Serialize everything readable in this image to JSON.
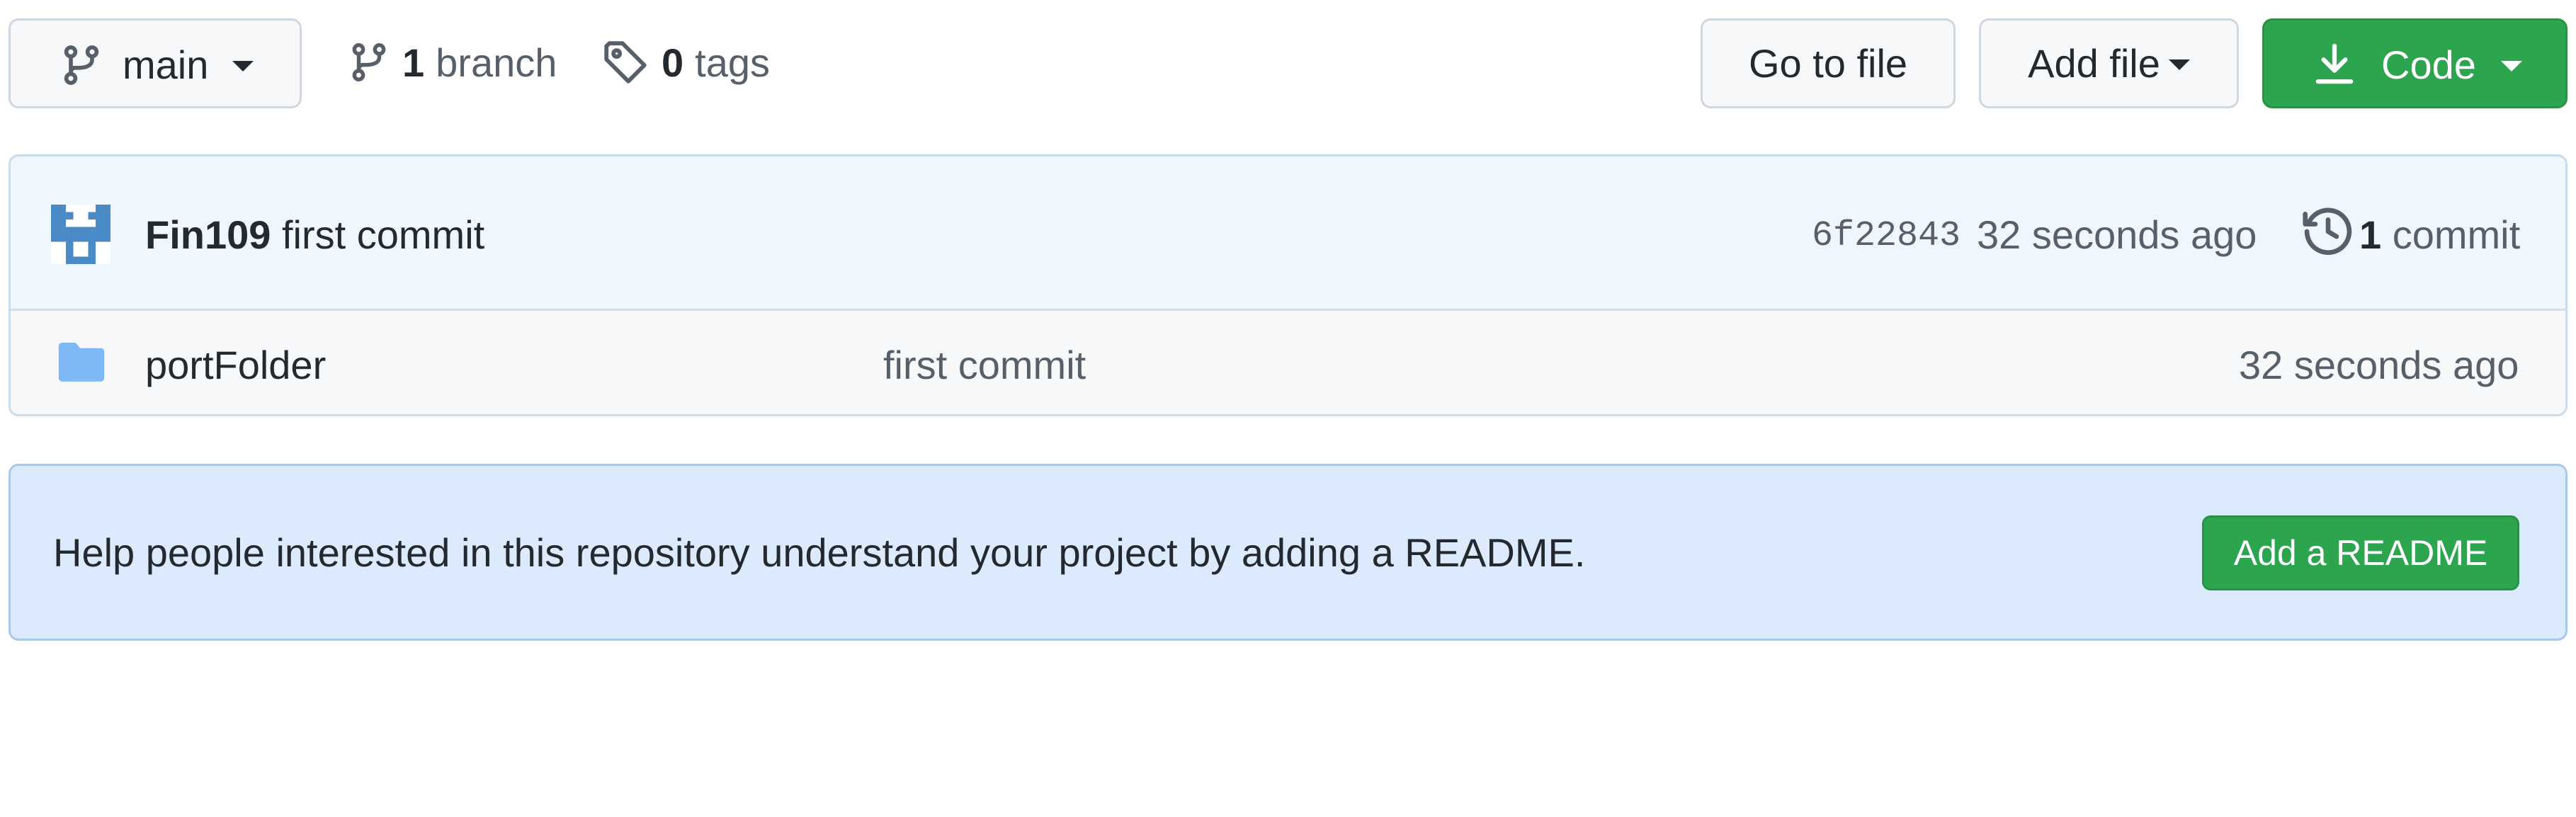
{
  "toolbar": {
    "branch_selector": {
      "label": "main",
      "icon": "git-branch-icon"
    },
    "branches": {
      "count": "1",
      "label": "branch",
      "icon": "git-branch-icon"
    },
    "tags": {
      "count": "0",
      "label": "tags",
      "icon": "tag-icon"
    },
    "go_to_file": "Go to file",
    "add_file": "Add file",
    "code": {
      "label": "Code",
      "icon": "download-icon",
      "color": "#2da44e"
    }
  },
  "latest_commit": {
    "author": "Fin109",
    "message": "first commit",
    "hash": "6f22843",
    "time": "32 seconds ago",
    "commits_count": "1",
    "commits_label": "commit",
    "history_icon": "history-icon",
    "avatar_color": "#4a8ac6"
  },
  "files": [
    {
      "name": "portFolder",
      "type": "folder",
      "icon": "folder-icon",
      "icon_color": "#7eb8f7",
      "message": "first commit",
      "time": "32 seconds ago"
    }
  ],
  "readme_prompt": {
    "text": "Help people interested in this repository understand your project by adding a README.",
    "button": "Add a README"
  }
}
